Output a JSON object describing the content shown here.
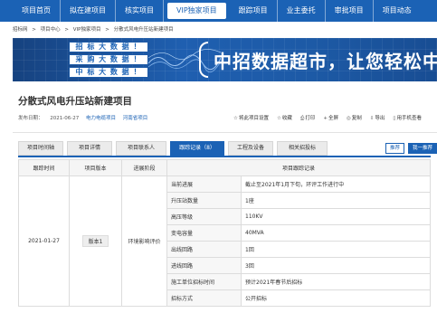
{
  "nav": {
    "items": [
      "项目首页",
      "拟在建项目",
      "核实项目",
      "VIP独家项目",
      "跟踪项目",
      "业主委托",
      "审批项目",
      "项目动态"
    ],
    "active_index": 3
  },
  "breadcrumb": [
    "招标网",
    ">",
    "项目中心",
    ">",
    "VIP独家项目",
    ">",
    "分散式风电升压站新建项目"
  ],
  "banner": {
    "tags": [
      "招 标 大 数 据 ！",
      "采 购 大 数 据 ！",
      "中 标 大 数 据 ！"
    ],
    "headline": "中招数据超市，让您轻松中标"
  },
  "project": {
    "title": "分散式风电升压站新建项目",
    "date_label": "发布日期：",
    "date": "2021-06-27",
    "category": "电力电缆项目",
    "region": "河南省项目"
  },
  "actions": [
    "将此项目设置",
    "收藏",
    "打印",
    "全屏",
    "复制",
    "导出",
    "用手机查看"
  ],
  "tabs": [
    "项目时间轴",
    "项目详情",
    "项目联系人",
    "跟踪记录（8）",
    "工程及设备",
    "相关招投标"
  ],
  "active_tab": 3,
  "right_buttons": [
    "推荐",
    "我一推荐"
  ],
  "table": {
    "headers": [
      "跟踪时间",
      "项目版本",
      "进展阶段",
      "项目跟踪记录"
    ],
    "date": "2021-01-27",
    "version": "版本1",
    "stage": "环境影响评价",
    "rows": [
      {
        "label": "当前进展",
        "value": "截止至2021年1月下旬，环评工作进行中"
      },
      {
        "label": "升压站数量",
        "value": "1座"
      },
      {
        "label": "高压等级",
        "value": "110KV"
      },
      {
        "label": "变电容量",
        "value": "40MVA"
      },
      {
        "label": "出线回路",
        "value": "1回"
      },
      {
        "label": "进线回路",
        "value": "3回"
      },
      {
        "label": "施工单位招标时间",
        "value": "预计2021年春节后招标"
      },
      {
        "label": "招标方式",
        "value": "公开招标"
      }
    ]
  }
}
